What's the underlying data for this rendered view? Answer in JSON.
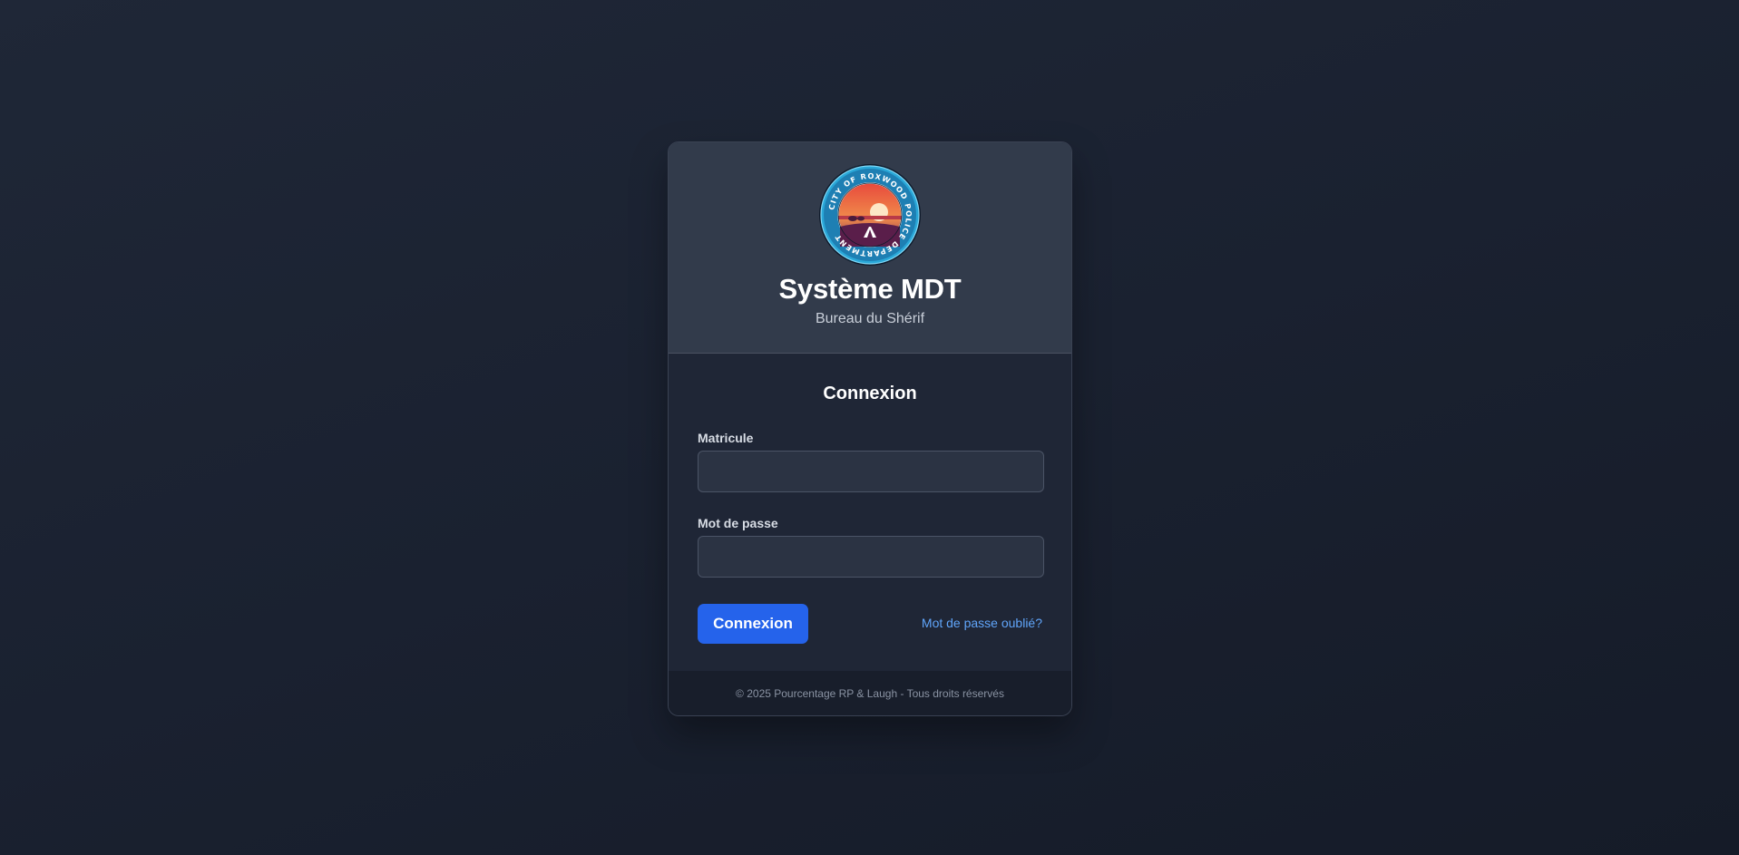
{
  "header": {
    "logo_text": "CITY OF ROXWOOD POLICE DEPARTMENT",
    "title": "Système MDT",
    "subtitle": "Bureau du Shérif"
  },
  "form": {
    "title": "Connexion",
    "matricule_label": "Matricule",
    "matricule_value": "",
    "password_label": "Mot de passe",
    "password_value": "",
    "submit_label": "Connexion",
    "forgot_label": "Mot de passe oublié?"
  },
  "footer": {
    "text": "© 2025 Pourcentage RP & Laugh - Tous droits réservés"
  },
  "colors": {
    "accent": "#2563eb",
    "link": "#60a5fa",
    "card_header": "#323b4b",
    "card_body": "#1f2636"
  },
  "icons": {
    "logo": "police-badge-icon"
  }
}
